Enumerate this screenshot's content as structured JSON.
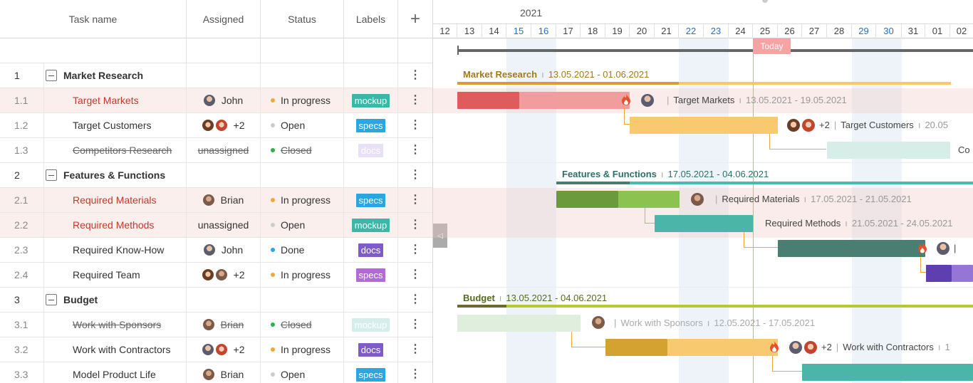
{
  "columns": {
    "task_name": "Task name",
    "assigned": "Assigned",
    "status": "Status",
    "labels": "Labels",
    "add": "+"
  },
  "timeline": {
    "year": "2021",
    "days": [
      "12",
      "13",
      "14",
      "15",
      "16",
      "17",
      "18",
      "19",
      "20",
      "21",
      "22",
      "23",
      "24",
      "25",
      "26",
      "27",
      "28",
      "29",
      "30",
      "31",
      "01",
      "02"
    ],
    "today_label": "Today"
  },
  "rows": [
    {
      "num": "1",
      "name": "Market Research"
    },
    {
      "num": "1.1",
      "name": "Target Markets",
      "assigned": "John",
      "status": "In progress",
      "label": "mockup"
    },
    {
      "num": "1.2",
      "name": "Target Customers",
      "assigned": "+2",
      "status": "Open",
      "label": "specs"
    },
    {
      "num": "1.3",
      "name": "Competitors Research",
      "assigned": "unassigned",
      "status": "Closed",
      "label": "docs"
    },
    {
      "num": "2",
      "name": "Features & Functions"
    },
    {
      "num": "2.1",
      "name": "Required Materials",
      "assigned": "Brian",
      "status": "In progress",
      "label": "specs"
    },
    {
      "num": "2.2",
      "name": "Required Methods",
      "assigned": "unassigned",
      "status": "Open",
      "label": "mockup"
    },
    {
      "num": "2.3",
      "name": "Required Know-How",
      "assigned": "John",
      "status": "Done",
      "label": "docs"
    },
    {
      "num": "2.4",
      "name": "Required Team",
      "assigned": "+2",
      "status": "In progress",
      "label": "specs"
    },
    {
      "num": "3",
      "name": "Budget"
    },
    {
      "num": "3.1",
      "name": "Work with Sponsors",
      "assigned": "Brian",
      "status": "Closed",
      "label": "mockup"
    },
    {
      "num": "3.2",
      "name": "Work with Contractors",
      "assigned": "+2",
      "status": "In progress",
      "label": "docs"
    },
    {
      "num": "3.3",
      "name": "Model Product Life",
      "assigned": "Brian",
      "status": "Open",
      "label": "specs"
    }
  ],
  "gantt": {
    "mr_name": "Market Research",
    "mr_dates": "13.05.2021 - 01.06.2021",
    "tm_name": "Target Markets",
    "tm_dates": "13.05.2021 - 19.05.2021",
    "tc_extra": "+2",
    "tc_name": "Target Customers",
    "tc_dates": "20.05",
    "co_name": "Co",
    "ff_name": "Features & Functions",
    "ff_dates": "17.05.2021 - 04.06.2021",
    "rm_name": "Required Materials",
    "rm_dates": "17.05.2021 - 21.05.2021",
    "rme_name": "Required Methods",
    "rme_dates": "21.05.2021 - 24.05.2021",
    "bu_name": "Budget",
    "bu_dates": "13.05.2021 - 04.06.2021",
    "ws_name": "Work with Sponsors",
    "ws_dates": "12.05.2021 - 17.05.2021",
    "wc_extra": "+2",
    "wc_name": "Work with Contractors",
    "wc_dates": "1",
    "sep": "|",
    "tick": "ı"
  },
  "colors": {
    "red_text": "#c0392b",
    "mockup": "#3bb6a7",
    "specs": "#2aa6e0",
    "docs": "#7f5bc7",
    "in_progress": "#f0a73a",
    "today": "#f5a3a3"
  }
}
